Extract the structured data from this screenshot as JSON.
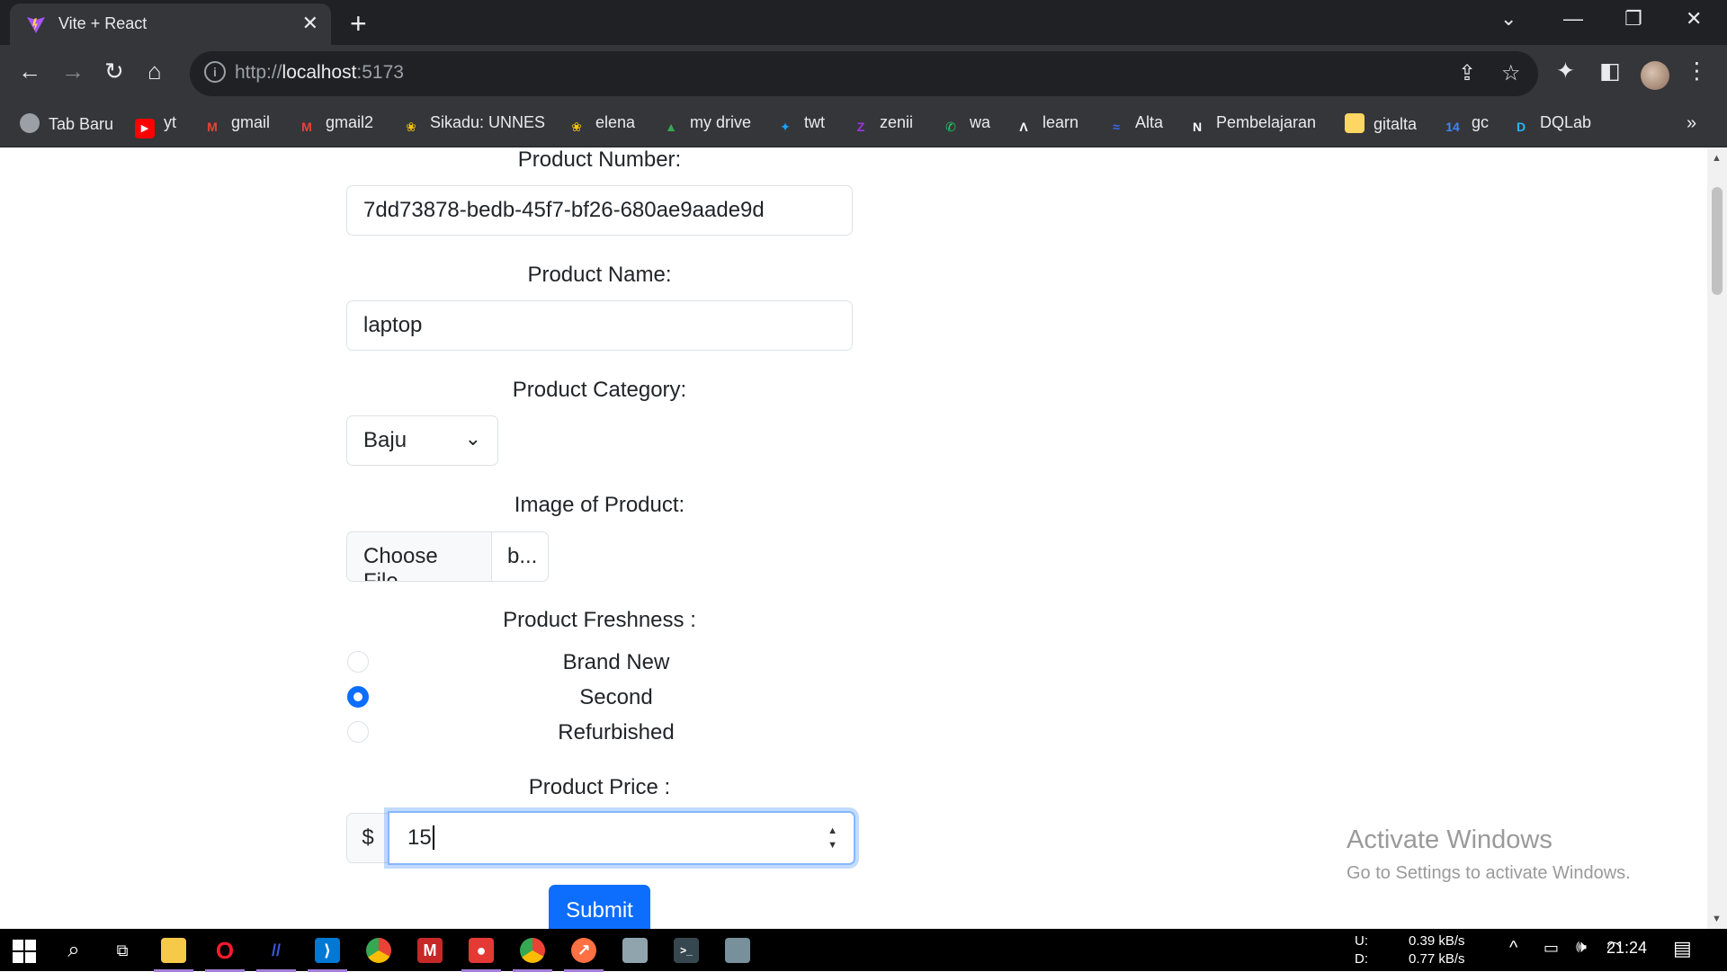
{
  "tab": {
    "title": "Vite + React",
    "close": "✕"
  },
  "window": {
    "minimize": "—",
    "restore": "❐",
    "close": "✕",
    "dropdown": "⌄"
  },
  "address": {
    "scheme": "http://",
    "host": "localhost",
    "port": ":5173"
  },
  "bookmarks": [
    {
      "label": "Tab Baru",
      "icon": "circle-icon",
      "color": "#9aa0a6"
    },
    {
      "label": "yt",
      "icon": "youtube-icon",
      "color": "#ff0000"
    },
    {
      "label": "gmail",
      "icon": "gmail-icon",
      "color": "#ea4335"
    },
    {
      "label": "gmail2",
      "icon": "gmail-icon",
      "color": "#ea4335"
    },
    {
      "label": "Sikadu: UNNES",
      "icon": "unnes-icon",
      "color": "#f4c20d"
    },
    {
      "label": "elena",
      "icon": "unnes-icon",
      "color": "#f4c20d"
    },
    {
      "label": "my drive",
      "icon": "drive-icon",
      "color": "#34a853"
    },
    {
      "label": "twt",
      "icon": "twitter-icon",
      "color": "#1da1f2"
    },
    {
      "label": "zenii",
      "icon": "zenius-icon",
      "color": "#a033e8"
    },
    {
      "label": "wa",
      "icon": "whatsapp-icon",
      "color": "#25d366"
    },
    {
      "label": "learn",
      "icon": "learn-icon",
      "color": "#ffffff"
    },
    {
      "label": "Alta",
      "icon": "alta-icon",
      "color": "#3d6bf5"
    },
    {
      "label": "Pembelajaran",
      "icon": "notion-icon",
      "color": "#ffffff"
    },
    {
      "label": "gitalta",
      "icon": "folder-icon",
      "color": "#fdd663"
    },
    {
      "label": "gc",
      "icon": "calendar-icon",
      "color": "#4285f4"
    },
    {
      "label": "DQLab",
      "icon": "dqlab-icon",
      "color": "#29b6f6"
    }
  ],
  "form": {
    "product_number_label": "Product Number:",
    "product_number_value": "7dd73878-bedb-45f7-bf26-680ae9aade9d",
    "product_name_label": "Product Name:",
    "product_name_value": "laptop",
    "category_label": "Product Category:",
    "category_value": "Baju",
    "image_label": "Image of Product:",
    "choose_file": "Choose File",
    "file_name": "b...",
    "freshness_label": "Product Freshness :",
    "freshness_options": [
      {
        "label": "Brand New",
        "checked": false
      },
      {
        "label": "Second",
        "checked": true
      },
      {
        "label": "Refurbished",
        "checked": false
      }
    ],
    "price_label": "Product Price :",
    "currency": "$",
    "price_value": "15",
    "submit": "Submit"
  },
  "watermark": {
    "title": "Activate Windows",
    "subtitle": "Go to Settings to activate Windows."
  },
  "system": {
    "upload_label": "U:",
    "download_label": "D:",
    "upload": "0.39 kB/s",
    "download": "0.77 kB/s",
    "time": "21:24"
  }
}
